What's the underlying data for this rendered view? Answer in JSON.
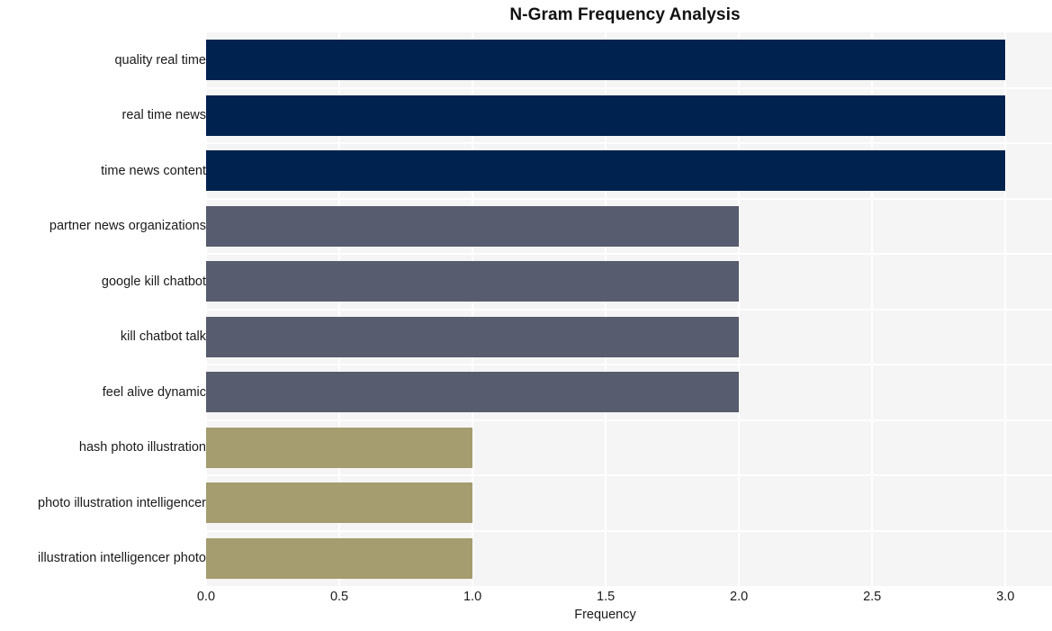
{
  "chart_data": {
    "type": "bar",
    "orientation": "horizontal",
    "title": "N-Gram Frequency Analysis",
    "xlabel": "Frequency",
    "ylabel": "",
    "categories": [
      "quality real time",
      "real time news",
      "time news content",
      "partner news organizations",
      "google kill chatbot",
      "kill chatbot talk",
      "feel alive dynamic",
      "hash photo illustration",
      "photo illustration intelligencer",
      "illustration intelligencer photo"
    ],
    "values": [
      3,
      3,
      3,
      2,
      2,
      2,
      2,
      1,
      1,
      1
    ],
    "bar_colors": [
      "#00224e",
      "#00224e",
      "#00224e",
      "#575c6e",
      "#575c6e",
      "#575c6e",
      "#575c6e",
      "#a59c6f",
      "#a59c6f",
      "#a59c6f"
    ],
    "xlim": [
      0,
      3.175
    ],
    "xticks": [
      0,
      0.5,
      1,
      1.5,
      2,
      2.5,
      3
    ],
    "xtick_labels": [
      "0.0",
      "0.5",
      "1.0",
      "1.5",
      "2.0",
      "2.5",
      "3.0"
    ],
    "grid": true,
    "grid_color": "#ffffff",
    "plot_background": "#f5f5f5",
    "figure_background": "#ffffff",
    "legend": null,
    "palette_name": "cividis"
  }
}
